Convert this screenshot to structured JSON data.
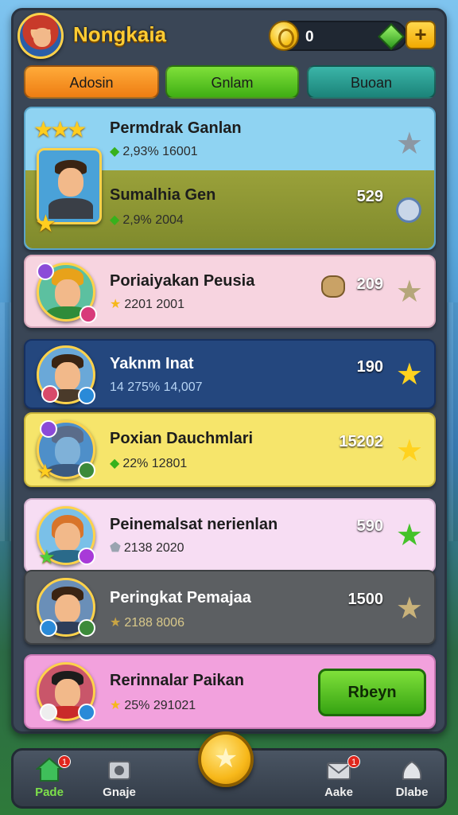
{
  "header": {
    "title": "Nongkaia",
    "coins": "0",
    "plus_label": "+"
  },
  "tabs": [
    {
      "label": "Adosin"
    },
    {
      "label": "Gnlam"
    },
    {
      "label": "Buoan"
    }
  ],
  "rows": [
    {
      "name": "Permdrak Ganlan",
      "sub": "2,93% 16001",
      "score": "",
      "star": "grey"
    },
    {
      "name": "Sumalhia Gen",
      "sub": "2,9% 2004",
      "score": "529",
      "star": "blue"
    },
    {
      "name": "Poriaiyakan Peusia",
      "sub": "2201 2001",
      "score": "209",
      "star": "olive"
    },
    {
      "name": "Yaknm Inat",
      "sub": "14 275%  14,007",
      "score": "190",
      "star": "gold"
    },
    {
      "name": "Poxian Dauchmlari",
      "sub": "22% 12801",
      "score": "15202",
      "star": "gold"
    },
    {
      "name": "Peinemalsat nerienlan",
      "sub": "2138 2020",
      "score": "590",
      "star": "green"
    },
    {
      "name": "Peringkat Pemajaa",
      "sub": "2188 8006",
      "score": "1500",
      "star": "tan"
    },
    {
      "name": "Rerinnalar Paikan",
      "sub": "25% 291021",
      "score": "",
      "star": ""
    }
  ],
  "play_label": "Rbeyn",
  "nav": [
    {
      "label": "Pade",
      "icon": "home-icon",
      "badge": "1"
    },
    {
      "label": "Gnaje",
      "icon": "camera-icon",
      "badge": ""
    },
    {
      "label": "Aake",
      "icon": "mail-icon",
      "badge": "1"
    },
    {
      "label": "Dlabe",
      "icon": "bag-icon",
      "badge": ""
    }
  ],
  "colors": {
    "title": "#ffcc33",
    "tab_orange": "#ee7d12",
    "tab_green": "#3fae14",
    "tab_teal": "#1b8379"
  }
}
